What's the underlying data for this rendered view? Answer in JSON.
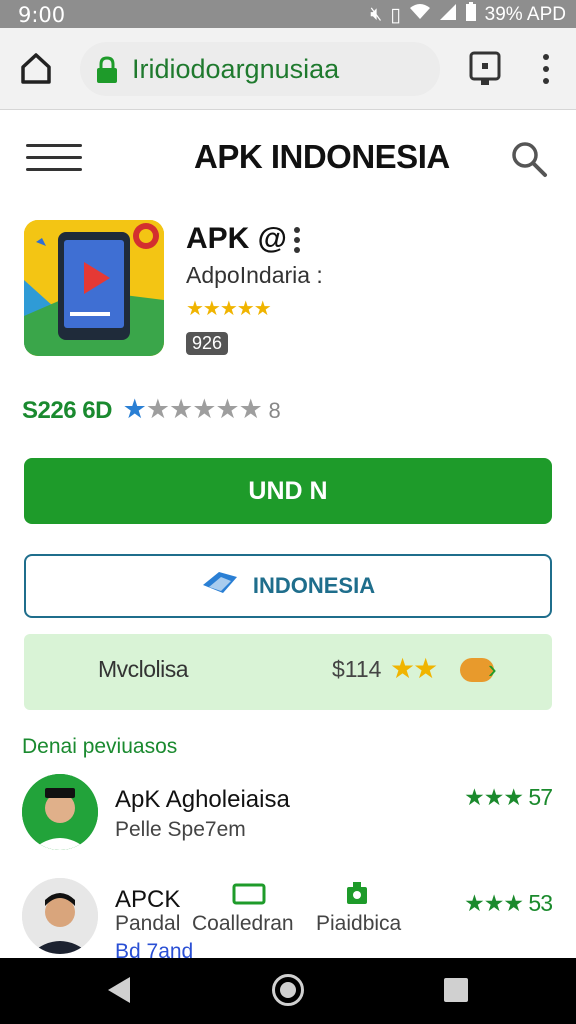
{
  "status_bar": {
    "time": "9:00",
    "battery_text": "39% APD",
    "icons": [
      "mute-icon",
      "vibrate-icon",
      "wifi-icon",
      "signal-icon",
      "battery-icon"
    ]
  },
  "browser": {
    "url": "Iridiodoargnusiaa",
    "icons": [
      "home-icon",
      "lock-icon",
      "tab-switch-icon",
      "overflow-menu-icon"
    ]
  },
  "header": {
    "title": "APK INDONESIA"
  },
  "app": {
    "name": "APK @",
    "developer": "AdpoIndaria :",
    "stars": "★★★★★",
    "badge": "926",
    "price": "S226 6D",
    "rating_stars": "★★★★★★",
    "rating_tail": "8"
  },
  "buttons": {
    "install_label": "UND N",
    "secondary_label": "INDONESIA"
  },
  "banner": {
    "label": "Mvclolisa",
    "count": "$114",
    "stars": "★★"
  },
  "section": {
    "title": "Denai peviuasos"
  },
  "list": [
    {
      "title": "ApK Agholeiaisa",
      "subtitle": "Pelle Spe7em",
      "rating_stars": "★★★",
      "rating_value": "57"
    },
    {
      "title": "APCK",
      "subtitle": "Pandal",
      "extra_1": "Coalledran",
      "extra_2": "Piaidbica",
      "extra_3": "Bd 7and",
      "rating_stars": "★★★",
      "rating_value": "53"
    }
  ],
  "colors": {
    "accent_green": "#1e9b2a",
    "link_green": "#1a8a2f",
    "outline_blue": "#1f6e8c",
    "banner_bg": "#d9f3d6"
  }
}
